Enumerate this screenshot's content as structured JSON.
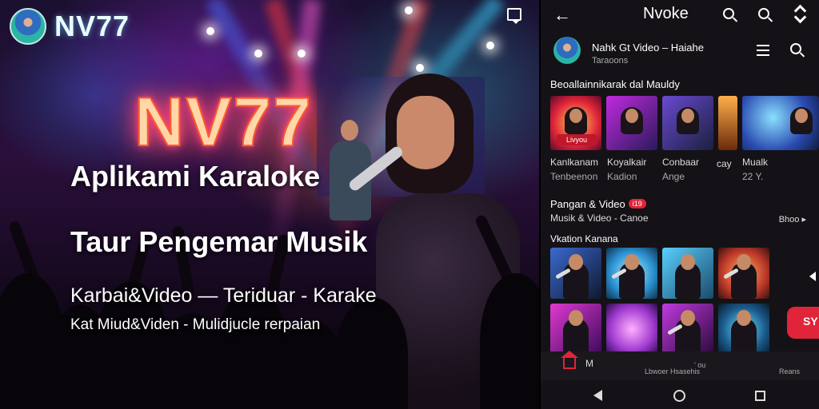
{
  "hero": {
    "brand_name": "NV77",
    "neon_title": "NV77",
    "line1": "Aplikami Karaloke",
    "line2": "Taur Pengemar Musik",
    "line3": "Karbai&Video — Teriduar - Karake",
    "line4": "Kat Miud&Viden - Mulidjucle rerpaian"
  },
  "phone": {
    "app_title": "Nvoke",
    "profile": {
      "name": "Nahk Gt Video – Haiahe",
      "sub": "Taraoons"
    },
    "section1": {
      "title": "Beoallainnikarak dal Mauldy",
      "badge": "Livyou",
      "captions": [
        {
          "line1": "Kanlkanam",
          "line2": "Tenbeenon"
        },
        {
          "line1": "Koyalkair",
          "line2": "Kadion"
        },
        {
          "line1": "Conbaar",
          "line2": "Ange"
        },
        {
          "line1": "cay",
          "line2": ""
        },
        {
          "line1": "Mualk",
          "line2": "22 Y."
        }
      ]
    },
    "section2": {
      "title": "Pangan & Video",
      "pill": "i19",
      "subtitle": "Musik & Video - Canoe",
      "more": "Bhoo ▸"
    },
    "section3": {
      "title": "Vkation Kanana"
    },
    "cta": "SY",
    "tabbar": {
      "tab1": "M",
      "tab2": "Lbwoer Hsasehis",
      "tab2b": "' ou",
      "tab3": "Reans"
    }
  },
  "colors": {
    "accent": "#e0243a",
    "neon": "#ff5a2a",
    "brand": "#e8fbff"
  }
}
